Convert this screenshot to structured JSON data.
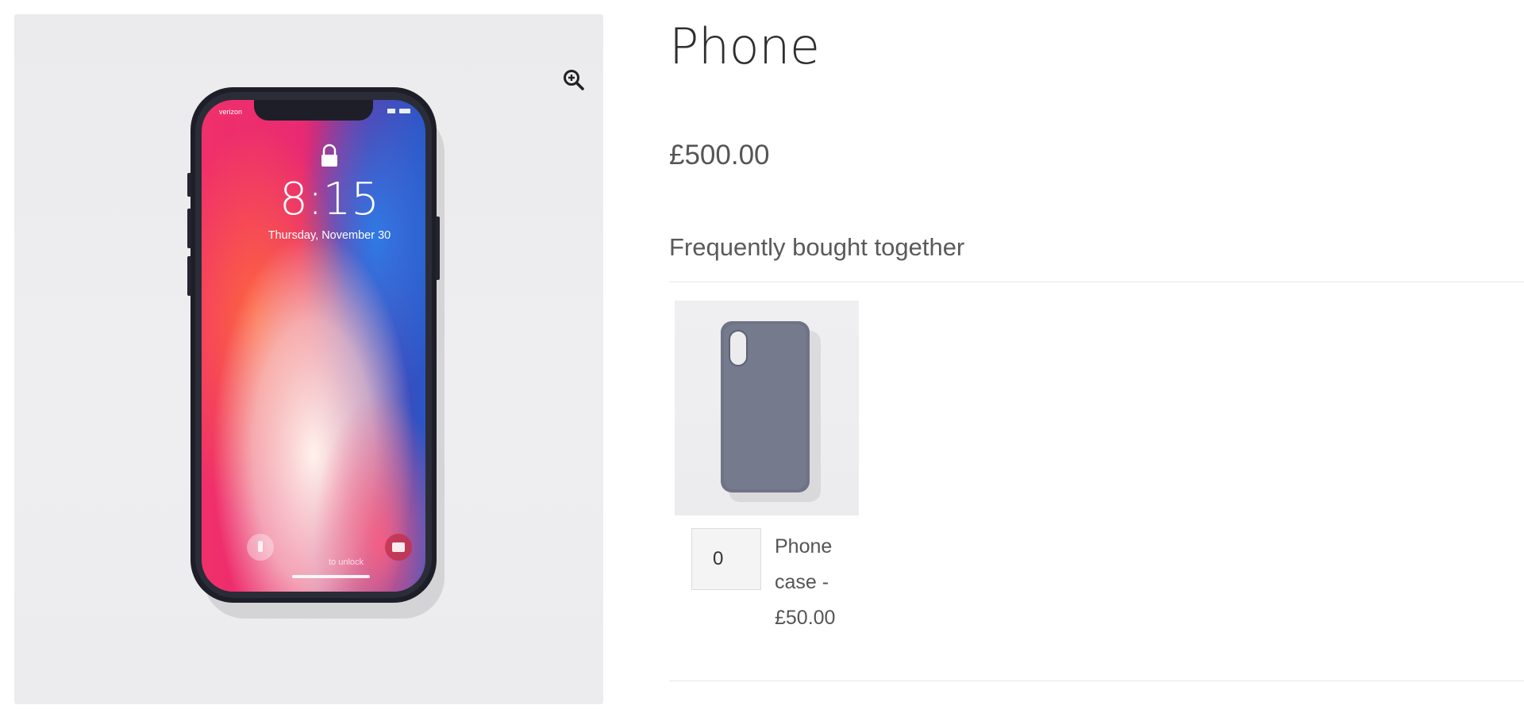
{
  "product": {
    "title": "Phone",
    "price": "£500.00",
    "main_image_icon": "smartphone-photo",
    "zoom_icon": "magnifier-plus-icon",
    "lockscreen": {
      "carrier": "verizon",
      "time": "8:15",
      "date": "Thursday, November 30",
      "unlock_hint": "to unlock"
    }
  },
  "frequently_bought_together": {
    "heading": "Frequently bought together",
    "items": [
      {
        "quantity": "0",
        "name_line1": "Phone",
        "name_line2": "case -",
        "price": "£50.00",
        "thumb_icon": "phone-case-photo"
      }
    ]
  },
  "colors": {
    "title_text": "#2f2f2f",
    "body_text": "#555555",
    "case_color": "#6f7385"
  }
}
